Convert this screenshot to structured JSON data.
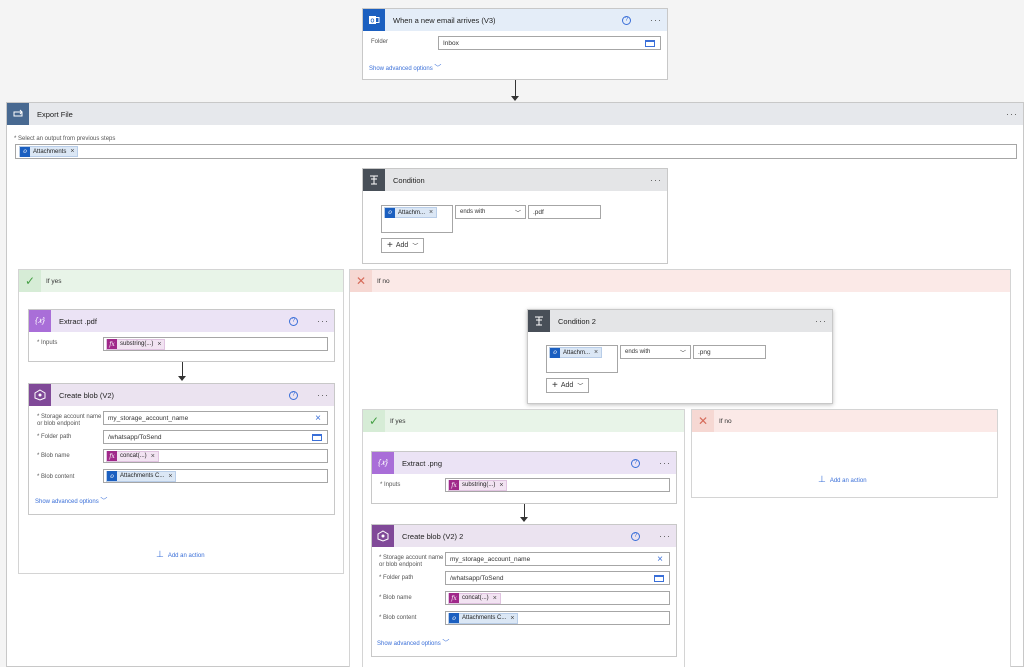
{
  "trigger": {
    "title": "When a new email arrives (V3)",
    "folder_label": "Folder",
    "folder_value": "Inbox",
    "advanced": "Show advanced options"
  },
  "foreach": {
    "title": "Export File",
    "select_label": "* Select an output from previous steps",
    "token": "Attachments"
  },
  "condition1": {
    "title": "Condition",
    "token": "Attachm...",
    "operator": "ends with",
    "value": ".pdf",
    "add": "Add"
  },
  "yes1": {
    "label": "If yes",
    "extract": {
      "title": "Extract .pdf",
      "inputs_label": "* Inputs",
      "token": "substring(...)"
    },
    "blob": {
      "title": "Create blob (V2)",
      "storage_label": "* Storage account name or blob endpoint",
      "storage_value": "my_storage_account_name",
      "folder_label": "* Folder path",
      "folder_value": "/whatsapp/ToSend",
      "name_label": "* Blob name",
      "name_token": "concat(...)",
      "content_label": "* Blob content",
      "content_token": "Attachments C...",
      "advanced": "Show advanced options"
    },
    "add_action": "Add an action"
  },
  "no1": {
    "label": "If no"
  },
  "condition2": {
    "title": "Condition 2",
    "token": "Attachm...",
    "operator": "ends with",
    "value": ".png",
    "add": "Add"
  },
  "yes2": {
    "label": "If yes",
    "extract": {
      "title": "Extract .png",
      "inputs_label": "* Inputs",
      "token": "substring(...)"
    },
    "blob": {
      "title": "Create blob (V2) 2",
      "storage_label": "* Storage account name or blob endpoint",
      "storage_value": "my_storage_account_name",
      "folder_label": "* Folder path",
      "folder_value": "/whatsapp/ToSend",
      "name_label": "* Blob name",
      "name_token": "concat(...)",
      "content_label": "* Blob content",
      "content_token": "Attachments C...",
      "advanced": "Show advanced options"
    }
  },
  "no2": {
    "label": "If no",
    "add_action": "Add an action"
  },
  "colors": {
    "outlook": "#1b5fc0",
    "foreach": "#486991",
    "condition": "#484f58",
    "expression": "#a96ed8",
    "storage": "#804998",
    "yes_bg": "#e8f4e8",
    "yes_icon": "#45a045",
    "no_bg": "#fbe9e7",
    "no_icon": "#d66b5a"
  }
}
